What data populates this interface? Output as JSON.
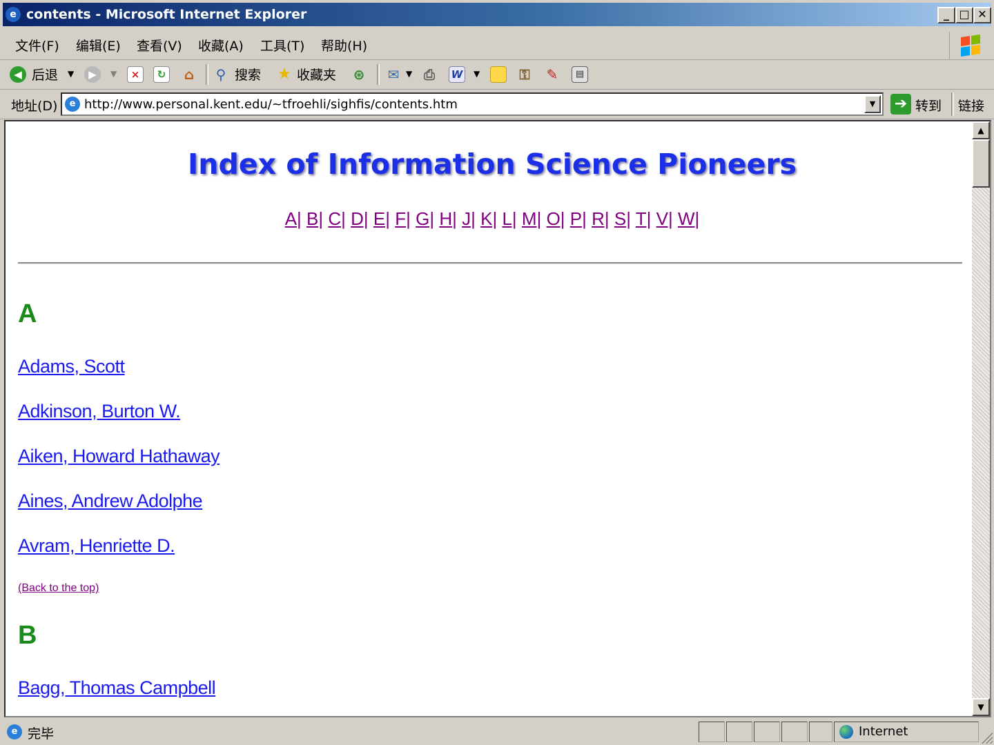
{
  "window": {
    "title": "contents - Microsoft Internet Explorer",
    "minimize": "_",
    "maximize": "□",
    "close": "✕"
  },
  "menu": [
    "文件(F)",
    "编辑(E)",
    "查看(V)",
    "收藏(A)",
    "工具(T)",
    "帮助(H)"
  ],
  "toolbar": {
    "back": "后退",
    "search": "搜索",
    "favorites": "收藏夹"
  },
  "address": {
    "label": "地址(D)",
    "url": "http://www.personal.kent.edu/~tfroehli/sighfis/contents.htm",
    "go": "转到",
    "links": "链接"
  },
  "page": {
    "title": "Index of Information Science Pioneers",
    "alphabet": [
      "A|",
      "B|",
      "C|",
      "D|",
      "E|",
      "F|",
      "G|",
      "H|",
      "J|",
      "K|",
      "L|",
      "M|",
      "O|",
      "P|",
      "R|",
      "S|",
      "T|",
      "V|",
      "W|"
    ],
    "sections": [
      {
        "letter": "A",
        "names": [
          "Adams, Scott",
          "Adkinson, Burton W.",
          "Aiken, Howard Hathaway",
          "Aines, Andrew Adolphe",
          "Avram, Henriette D."
        ],
        "back": "(Back to the top)"
      },
      {
        "letter": "B",
        "names": [
          "Bagg, Thomas Campbell"
        ]
      }
    ],
    "link_color": "#1a1aee",
    "visited_color": "#800080",
    "heading_color": "#1a8a1a",
    "title_color": "#1b2fe6"
  },
  "status": {
    "text": "完毕",
    "zone": "Internet"
  }
}
